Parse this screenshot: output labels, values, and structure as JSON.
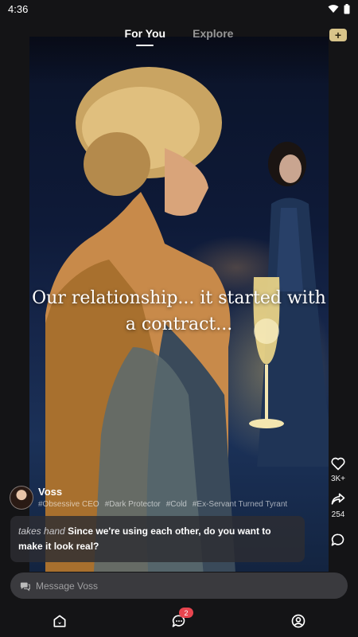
{
  "status_bar": {
    "time": "4:36",
    "wifi_icon": "wifi-icon",
    "battery_icon": "battery-icon"
  },
  "tabs": [
    {
      "label": "For You",
      "active": true
    },
    {
      "label": "Explore",
      "active": false
    }
  ],
  "add_button": {
    "label": "+"
  },
  "caption": "Our relationship... it started with a contract...",
  "actions": {
    "like_count": "3K+",
    "share_count": "254"
  },
  "character": {
    "name": "Voss",
    "tags": [
      "#Obsessive CEO",
      "#Dark Protector",
      "#Cold",
      "#Ex-Servant Turned Tyrant"
    ]
  },
  "message": {
    "action_text": "takes hand",
    "speech_text": "Since we're using each other, do you want to make it look real?"
  },
  "input": {
    "placeholder": "Message Voss"
  },
  "nav": {
    "messages_badge": "2"
  },
  "colors": {
    "background": "#141416",
    "accent_gold": "#d8c48a",
    "badge_red": "#e8454f"
  }
}
